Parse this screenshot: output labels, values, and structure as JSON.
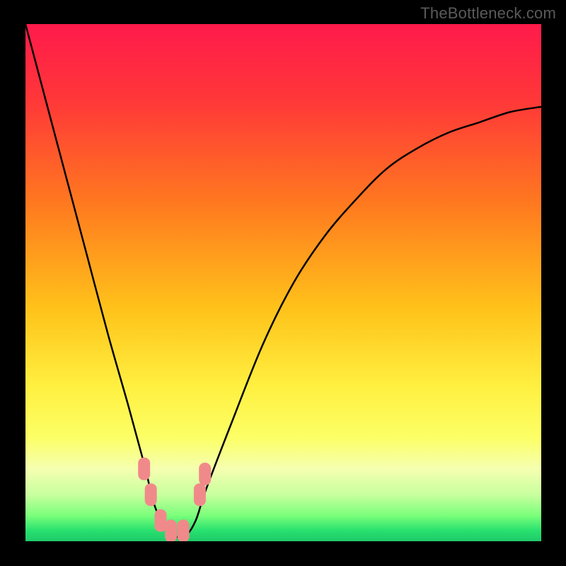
{
  "watermark": "TheBottleneck.com",
  "chart_data": {
    "type": "line",
    "title": "",
    "xlabel": "",
    "ylabel": "",
    "xlim": [
      0,
      100
    ],
    "ylim": [
      0,
      100
    ],
    "grid": false,
    "legend": false,
    "gradient_stops": [
      {
        "offset": 0,
        "color": "#ff1a4b"
      },
      {
        "offset": 15,
        "color": "#ff3838"
      },
      {
        "offset": 35,
        "color": "#ff7a1f"
      },
      {
        "offset": 55,
        "color": "#ffc21a"
      },
      {
        "offset": 70,
        "color": "#fff040"
      },
      {
        "offset": 80,
        "color": "#fcff66"
      },
      {
        "offset": 86,
        "color": "#f5ffb0"
      },
      {
        "offset": 91,
        "color": "#c8ff9e"
      },
      {
        "offset": 95,
        "color": "#7bff7b"
      },
      {
        "offset": 98,
        "color": "#27e06e"
      },
      {
        "offset": 100,
        "color": "#1fc96a"
      }
    ],
    "series": [
      {
        "name": "curve",
        "color": "#000000",
        "x": [
          0,
          4,
          8,
          12,
          16,
          20,
          23,
          25,
          27,
          29,
          31,
          33,
          35,
          40,
          46,
          52,
          58,
          64,
          70,
          76,
          82,
          88,
          94,
          100
        ],
        "y": [
          100,
          85,
          70,
          55,
          40,
          26,
          15,
          7,
          3,
          1,
          1,
          4,
          10,
          23,
          38,
          50,
          59,
          66,
          72,
          76,
          79,
          81,
          83,
          84
        ]
      }
    ],
    "markers": [
      {
        "x": 23.0,
        "y": 14.0,
        "color": "#f08a8a"
      },
      {
        "x": 24.3,
        "y": 9.0,
        "color": "#f08a8a"
      },
      {
        "x": 26.2,
        "y": 4.0,
        "color": "#f08a8a"
      },
      {
        "x": 28.2,
        "y": 2.0,
        "color": "#f08a8a"
      },
      {
        "x": 30.6,
        "y": 2.0,
        "color": "#f08a8a"
      },
      {
        "x": 33.8,
        "y": 9.0,
        "color": "#f08a8a"
      },
      {
        "x": 34.8,
        "y": 13.0,
        "color": "#f08a8a"
      }
    ]
  }
}
